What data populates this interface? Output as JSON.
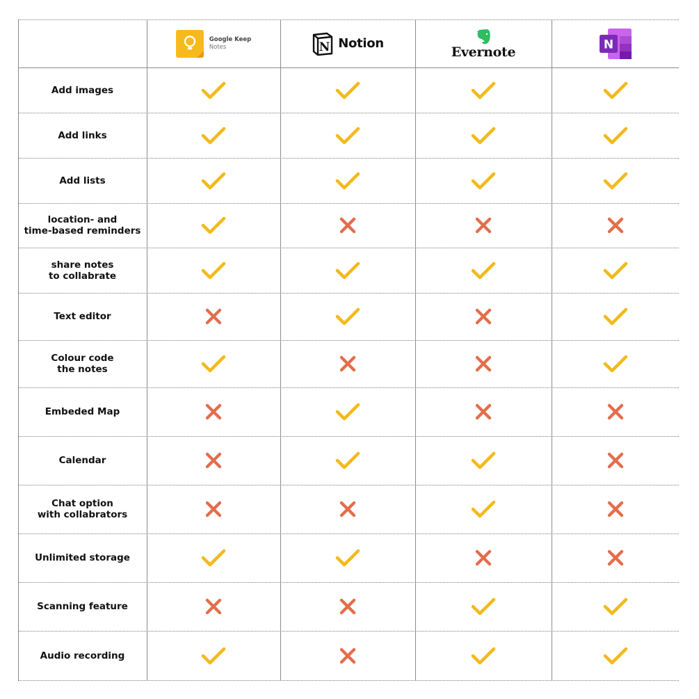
{
  "header": {
    "apps": [
      {
        "id": "google-keep",
        "name": "Google Keep",
        "sub": "Notes"
      },
      {
        "id": "notion",
        "name": "Notion"
      },
      {
        "id": "evernote",
        "name": "Evernote"
      },
      {
        "id": "onenote",
        "name": ""
      }
    ]
  },
  "colors": {
    "check": "#F2BA1D",
    "cross": "#E36D4B",
    "keep_yellow": "#F7BA1D",
    "evernote_green": "#2DBE60",
    "onenote_purple": "#7B2BB8"
  },
  "chart_data": {
    "type": "table",
    "columns": [
      "Google Keep Notes",
      "Notion",
      "Evernote",
      "OneNote"
    ],
    "rows": [
      {
        "feature": "Add images",
        "values": [
          true,
          true,
          true,
          true
        ]
      },
      {
        "feature": "Add links",
        "values": [
          true,
          true,
          true,
          true
        ]
      },
      {
        "feature": "Add lists",
        "values": [
          true,
          true,
          true,
          true
        ]
      },
      {
        "feature": "location- and\ntime-based reminders",
        "values": [
          true,
          false,
          false,
          false
        ]
      },
      {
        "feature": "share notes\nto collabrate",
        "values": [
          true,
          true,
          true,
          true
        ]
      },
      {
        "feature": "Text editor",
        "values": [
          false,
          true,
          false,
          true
        ]
      },
      {
        "feature": "Colour code\nthe notes",
        "values": [
          true,
          false,
          false,
          true
        ]
      },
      {
        "feature": "Embeded Map",
        "values": [
          false,
          true,
          false,
          false
        ]
      },
      {
        "feature": "Calendar",
        "values": [
          false,
          true,
          true,
          false
        ]
      },
      {
        "feature": "Chat option\nwith collabrators",
        "values": [
          false,
          false,
          true,
          false
        ]
      },
      {
        "feature": "Unlimited storage",
        "values": [
          true,
          true,
          false,
          false
        ]
      },
      {
        "feature": "Scanning feature",
        "values": [
          false,
          false,
          true,
          true
        ]
      },
      {
        "feature": "Audio recording",
        "values": [
          true,
          false,
          true,
          true
        ]
      }
    ]
  }
}
